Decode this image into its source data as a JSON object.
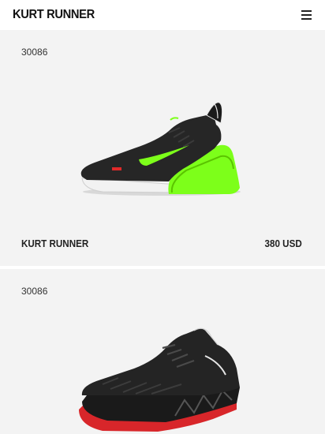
{
  "header": {
    "brand": "KURT RUNNER",
    "menu_icon": "hamburger-menu-icon"
  },
  "products": [
    {
      "sku": "30086",
      "name": "KURT RUNNER",
      "price": "380 USD",
      "image": "black-and-neon-green-sneaker",
      "accent": "#7dff1a"
    },
    {
      "sku": "30086",
      "image": "black-knit-sneaker-with-red-sole",
      "accent": "#e02a2a"
    }
  ]
}
